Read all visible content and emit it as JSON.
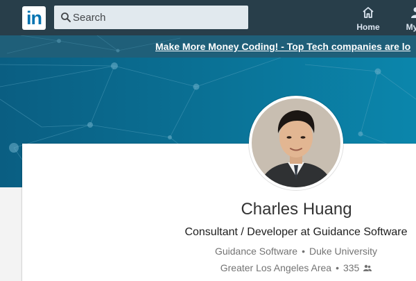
{
  "nav": {
    "logo_text": "in",
    "search_placeholder": "Search",
    "items": [
      {
        "label": "Home",
        "icon": "home-icon"
      },
      {
        "label": "My N",
        "icon": "my-network-icon"
      }
    ]
  },
  "banner": {
    "text": "Make More Money Coding! - Top Tech companies are lo"
  },
  "profile": {
    "name": "Charles Huang",
    "headline": "Consultant / Developer at Guidance Software",
    "company": "Guidance Software",
    "school": "Duke University",
    "location": "Greater Los Angeles Area",
    "connections": "335",
    "separator": "•"
  },
  "colors": {
    "nav_bg": "#283e4a",
    "brand": "#0073b1",
    "hero": "#0a6f93"
  }
}
